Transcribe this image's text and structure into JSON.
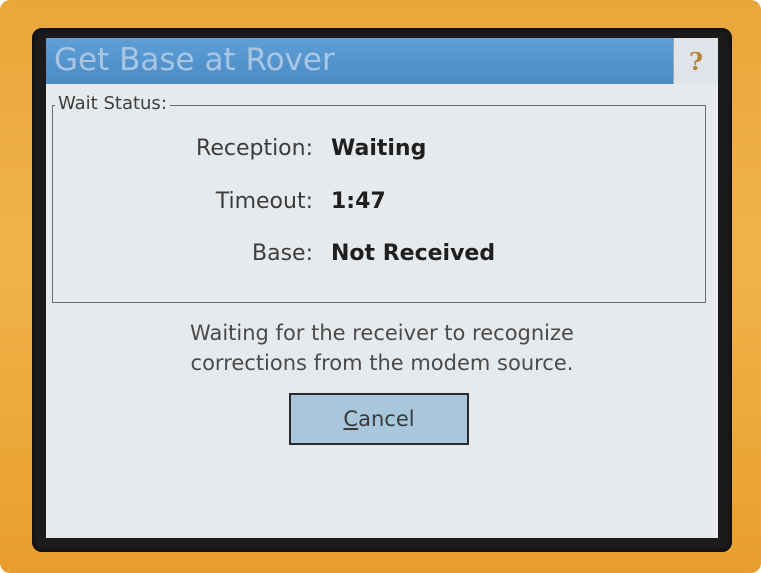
{
  "window": {
    "title": "Get Base at Rover",
    "help_glyph": "?"
  },
  "status_group": {
    "label": "Wait Status:",
    "rows": [
      {
        "label": "Reception:",
        "value": "Waiting"
      },
      {
        "label": "Timeout:",
        "value": "1:47"
      },
      {
        "label": "Base:",
        "value": "Not Received"
      }
    ]
  },
  "message": {
    "line1": "Waiting for the receiver to recognize",
    "line2": "corrections from the modem source."
  },
  "cancel_button": {
    "label_mnemonic": "C",
    "label_rest": "ancel"
  },
  "colors": {
    "titlebar": "#4a8ac6",
    "title_text": "#a8c6e4",
    "screen_bg": "#e7eaed",
    "button_bg": "#a9c7dc",
    "device_body": "#e9a63a"
  },
  "icons": {
    "help": "help-icon"
  }
}
